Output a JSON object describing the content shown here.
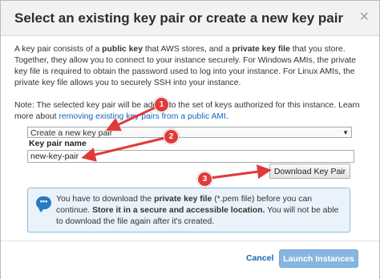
{
  "dialog": {
    "title": "Select an existing key pair or create a new key pair",
    "close": "×"
  },
  "description": {
    "s1": "A key pair consists of a ",
    "b1": "public key",
    "s2": " that AWS stores, and a ",
    "b2": "private key file",
    "s3": " that you store. Together, they allow you to connect to your instance securely. For Windows AMIs, the private key file is required to obtain the password used to log into your instance. For Linux AMIs, the private key file allows you to securely SSH into your instance."
  },
  "note": {
    "text": "Note: The selected key pair will be added to the set of keys authorized for this instance. Learn more about ",
    "link": "removing existing key pairs from a public AMI",
    "end": "."
  },
  "keypair_select": {
    "value": "Create a new key pair"
  },
  "keypair_name": {
    "label": "Key pair name",
    "value": "new-key-pair"
  },
  "download_button": "Download Key Pair",
  "alert": {
    "s1": "You have to download the ",
    "b1": "private key file",
    "s2": " (*.pem file) before you can continue. ",
    "b2": "Store it in a secure and accessible location.",
    "s3": " You will not be able to download the file again after it's created.",
    "icon": "speech-bubble-icon"
  },
  "footer": {
    "cancel": "Cancel",
    "launch": "Launch Instances"
  },
  "annotations": [
    {
      "number": "1"
    },
    {
      "number": "2"
    },
    {
      "number": "3"
    }
  ],
  "colors": {
    "link": "#1166bb",
    "annotation": "#e03a3a",
    "primary_disabled": "#86b6e0",
    "alert_bg": "#eaf3fb"
  }
}
